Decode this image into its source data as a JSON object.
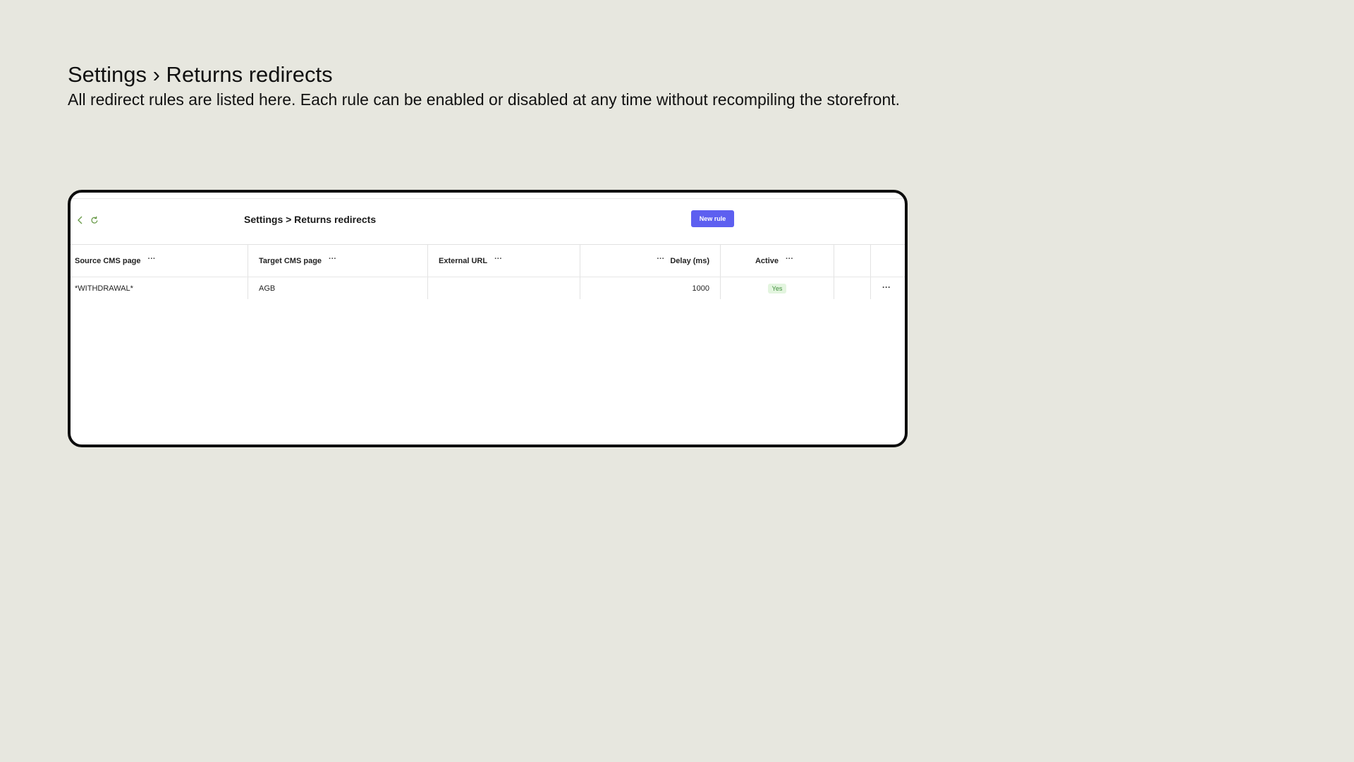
{
  "page": {
    "title": "Settings › Returns redirects",
    "description": "All redirect rules are listed here. Each rule can be enabled or disabled at any time without recompiling the storefront."
  },
  "frame": {
    "title": "Settings > Returns redirects",
    "new_rule_label": "New rule"
  },
  "icons": {
    "back": "chevron-left-icon",
    "refresh": "refresh-icon",
    "more": "ellipsis-icon"
  },
  "colors": {
    "accent": "#5d5ff0",
    "nav_icon": "#6a9b4a",
    "badge_bg": "#e3f5df",
    "badge_text": "#3e8d3a"
  },
  "table": {
    "columns": [
      {
        "label": "Source CMS page"
      },
      {
        "label": "Target CMS page"
      },
      {
        "label": "External URL"
      },
      {
        "label": "Delay (ms)"
      },
      {
        "label": "Active"
      }
    ],
    "rows": [
      {
        "source": "*WITHDRAWAL*",
        "target": "AGB",
        "external_url": "",
        "delay": "1000",
        "active": "Yes"
      }
    ]
  }
}
